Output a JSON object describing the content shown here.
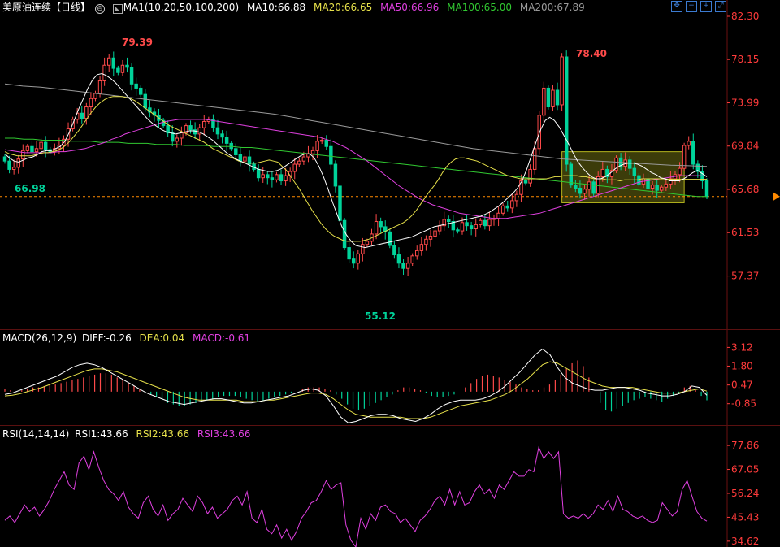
{
  "header": {
    "title": "美原油连续",
    "period": "【日线】",
    "ma_label": "MA1(10,20,50,100,200)",
    "ma10": "MA10:66.88",
    "ma20": "MA20:66.65",
    "ma50": "MA50:66.96",
    "ma100": "MA100:65.00",
    "ma200": "MA200:67.89",
    "icons": [
      "move-icon",
      "zoom-out-icon",
      "zoom-in-icon",
      "expand-icon"
    ]
  },
  "colors": {
    "up": "#ff4a4a",
    "down": "#00d39a",
    "ma10": "#ffffff",
    "ma20": "#e6e04a",
    "ma50": "#e040e0",
    "ma100": "#31c831",
    "ma200": "#9a9a9a",
    "axis": "#ff3b3b",
    "diff": "#ffffff",
    "dea": "#e6e04a",
    "rsi": "#e040e0",
    "box": "#b5b51e"
  },
  "price_axis": {
    "ticks": [
      "82.30",
      "78.15",
      "73.99",
      "69.84",
      "65.68",
      "61.53",
      "57.37"
    ],
    "range": [
      52.5,
      82.3
    ]
  },
  "annotations": {
    "high1": "79.39",
    "low1": "66.98",
    "high2": "78.40",
    "low2": "55.12",
    "last_price": "65.00"
  },
  "macd": {
    "label": "MACD(26,12,9)",
    "diff": "DIFF:-0.26",
    "dea": "DEA:0.04",
    "macd": "MACD:-0.61",
    "ticks": [
      "3.12",
      "1.80",
      "0.47",
      "-0.85"
    ],
    "range": [
      -2.3,
      3.2
    ]
  },
  "rsi": {
    "label": "RSI(14,14,14)",
    "rsi1": "RSI1:43.66",
    "rsi2": "RSI2:43.66",
    "rsi3": "RSI3:43.66",
    "ticks": [
      "77.86",
      "67.05",
      "56.24",
      "45.43",
      "34.62"
    ],
    "range": [
      32,
      79
    ]
  },
  "chart_data": {
    "type": "candlestick",
    "title": "美原油连续【日线】",
    "close": [
      68.4,
      67.6,
      67.8,
      68.6,
      69.4,
      69.8,
      69.3,
      69.6,
      70.2,
      69.5,
      69.3,
      69.6,
      69.9,
      70.5,
      71.5,
      72.4,
      73.0,
      72.5,
      73.6,
      74.4,
      74.9,
      76.1,
      77.6,
      78.3,
      77.3,
      76.9,
      77.6,
      77.4,
      75.8,
      75.4,
      74.8,
      73.5,
      73.1,
      72.8,
      72.3,
      71.8,
      71.1,
      70.3,
      70.6,
      71.1,
      71.8,
      71.4,
      71.0,
      71.6,
      72.2,
      72.4,
      71.6,
      71.0,
      70.7,
      70.1,
      69.6,
      69.0,
      68.4,
      68.8,
      68.1,
      67.6,
      66.8,
      67.1,
      66.8,
      66.6,
      67.1,
      66.5,
      67.0,
      67.4,
      68.1,
      68.4,
      68.8,
      69.1,
      69.4,
      70.3,
      70.4,
      69.8,
      68.1,
      66.0,
      62.7,
      60.1,
      59.0,
      58.6,
      59.5,
      60.4,
      60.7,
      61.4,
      62.6,
      62.1,
      61.6,
      60.3,
      59.4,
      58.6,
      58.1,
      58.6,
      59.3,
      59.8,
      60.4,
      60.9,
      61.2,
      61.7,
      62.2,
      62.8,
      62.6,
      61.8,
      61.7,
      62.5,
      62.2,
      61.9,
      62.3,
      62.7,
      62.2,
      62.8,
      62.9,
      63.4,
      64.1,
      63.9,
      64.6,
      65.2,
      66.5,
      66.3,
      67.6,
      69.6,
      72.8,
      75.4,
      73.6,
      75.2,
      73.8,
      78.4,
      68.1,
      66.1,
      65.8,
      65.3,
      65.7,
      66.4,
      65.3,
      66.9,
      67.6,
      66.9,
      67.5,
      68.7,
      67.9,
      68.5,
      67.7,
      67.0,
      66.2,
      66.7,
      65.8,
      66.1,
      65.6,
      65.9,
      66.2,
      66.7,
      67.1,
      67.7,
      69.9,
      70.3,
      68.1,
      67.4,
      66.5,
      65.0
    ],
    "ma10": [
      69.1,
      68.7,
      68.4,
      68.3,
      68.5,
      68.7,
      68.8,
      69.0,
      69.3,
      69.4,
      69.4,
      69.6,
      69.8,
      70.3,
      71.2,
      72.3,
      73.4,
      74.4,
      75.4,
      76.2,
      76.7,
      76.8,
      76.6,
      76.3,
      75.9,
      75.4,
      74.9,
      74.4,
      73.9,
      73.4,
      72.9,
      72.4,
      72.0,
      71.7,
      71.4,
      71.2,
      71.1,
      71.0,
      71.1,
      71.2,
      71.3,
      71.3,
      71.2,
      71.0,
      70.7,
      70.4,
      70.0,
      69.6,
      69.2,
      68.9,
      68.6,
      68.4,
      68.2,
      68.0,
      67.8,
      67.6,
      67.5,
      67.4,
      67.4,
      67.5,
      67.7,
      68.0,
      68.3,
      68.6,
      68.9,
      69.1,
      69.1,
      68.7,
      67.9,
      66.9,
      65.7,
      64.4,
      63.2,
      62.1,
      61.3,
      60.7,
      60.3,
      60.2,
      60.1,
      60.2,
      60.3,
      60.4,
      60.5,
      60.6,
      60.7,
      60.8,
      60.9,
      61.0,
      61.1,
      61.3,
      61.5,
      61.7,
      61.9,
      62.1,
      62.2,
      62.3,
      62.4,
      62.5,
      62.6,
      62.7,
      62.8,
      62.9,
      63.0,
      63.1,
      63.3,
      63.5,
      63.8,
      64.1,
      64.5,
      64.9,
      65.3,
      65.8,
      66.5,
      67.6,
      68.9,
      70.2,
      71.4,
      72.3,
      72.6,
      72.3,
      71.7,
      70.9,
      70.1,
      69.2,
      68.4,
      67.8,
      67.3,
      66.9,
      66.7,
      66.7,
      66.9,
      67.2,
      67.6,
      67.9,
      68.1,
      68.2,
      68.2,
      68.1,
      67.9,
      67.6,
      67.3,
      67.1,
      66.8,
      66.7,
      66.5,
      66.5,
      66.5,
      66.7,
      67.0,
      67.3,
      67.5,
      67.2,
      66.9
    ],
    "ma20": [
      69.3,
      69.1,
      69.0,
      68.9,
      68.9,
      68.9,
      68.9,
      69.0,
      69.1,
      69.2,
      69.2,
      69.3,
      69.4,
      69.6,
      69.9,
      70.3,
      70.8,
      71.3,
      71.9,
      72.5,
      73.1,
      73.6,
      74.0,
      74.3,
      74.5,
      74.6,
      74.6,
      74.6,
      74.5,
      74.4,
      74.2,
      73.9,
      73.6,
      73.3,
      73.0,
      72.7,
      72.4,
      72.1,
      71.8,
      71.6,
      71.4,
      71.2,
      71.0,
      70.8,
      70.6,
      70.4,
      70.2,
      69.9,
      69.6,
      69.4,
      69.2,
      69.0,
      68.8,
      68.6,
      68.4,
      68.3,
      68.2,
      68.2,
      68.2,
      68.3,
      68.4,
      68.5,
      68.4,
      68.3,
      67.9,
      67.5,
      66.9,
      66.3,
      65.7,
      65.0,
      64.3,
      63.6,
      63.0,
      62.4,
      61.9,
      61.5,
      61.2,
      61.0,
      60.8,
      60.7,
      60.7,
      60.7,
      60.7,
      60.8,
      60.9,
      61.1,
      61.3,
      61.5,
      61.7,
      61.9,
      62.1,
      62.3,
      62.5,
      62.8,
      63.2,
      63.7,
      64.3,
      64.9,
      65.5,
      66.0,
      66.6,
      67.3,
      67.9,
      68.3,
      68.6,
      68.7,
      68.7,
      68.6,
      68.5,
      68.4,
      68.2,
      68.0,
      67.8,
      67.6,
      67.4,
      67.2,
      67.0,
      66.9,
      66.8,
      66.7,
      66.7,
      66.7,
      66.7,
      66.7,
      66.7,
      66.7,
      66.8,
      66.9,
      66.9,
      67.0,
      67.0,
      67.0,
      67.0,
      66.9,
      66.9,
      66.8,
      66.7,
      66.7,
      66.7,
      66.6,
      66.6,
      66.6,
      66.5,
      66.6,
      66.6,
      66.6,
      66.6,
      66.7,
      66.7,
      66.7,
      66.7,
      66.7,
      66.7,
      66.65,
      66.65,
      66.65,
      66.65,
      66.65,
      66.65,
      66.65,
      66.65,
      66.65,
      66.65
    ],
    "ma50": [
      69.5,
      69.4,
      69.3,
      69.2,
      69.2,
      69.2,
      69.2,
      69.2,
      69.3,
      69.3,
      69.4,
      69.5,
      69.6,
      69.8,
      70.0,
      70.2,
      70.5,
      70.7,
      71.0,
      71.2,
      71.4,
      71.6,
      71.8,
      72.0,
      72.2,
      72.3,
      72.4,
      72.4,
      72.4,
      72.4,
      72.4,
      72.3,
      72.2,
      72.1,
      72.0,
      71.9,
      71.8,
      71.7,
      71.6,
      71.5,
      71.4,
      71.3,
      71.2,
      71.1,
      71.0,
      70.9,
      70.8,
      70.7,
      70.5,
      70.3,
      70.0,
      69.7,
      69.3,
      68.9,
      68.5,
      68.0,
      67.5,
      67.0,
      66.5,
      66.0,
      65.6,
      65.2,
      64.8,
      64.5,
      64.2,
      64.0,
      63.8,
      63.6,
      63.4,
      63.3,
      63.2,
      63.1,
      63.0,
      62.9,
      62.9,
      62.9,
      63.0,
      63.1,
      63.2,
      63.3,
      63.4,
      63.6,
      63.8,
      64.0,
      64.2,
      64.4,
      64.6,
      64.8,
      65.0,
      65.2,
      65.4,
      65.6,
      65.8,
      66.0,
      66.2,
      66.4,
      66.5,
      66.6,
      66.7,
      66.8,
      66.9,
      67.0,
      67.0,
      67.0,
      67.0,
      66.96
    ],
    "ma100": [
      70.6,
      70.6,
      70.5,
      70.5,
      70.4,
      70.4,
      70.4,
      70.3,
      70.3,
      70.3,
      70.2,
      70.2,
      70.2,
      70.1,
      70.1,
      70.1,
      70.0,
      70.0,
      70.0,
      69.9,
      69.9,
      69.9,
      69.8,
      69.8,
      69.8,
      69.7,
      69.7,
      69.6,
      69.5,
      69.4,
      69.3,
      69.2,
      69.1,
      69.0,
      68.9,
      68.8,
      68.7,
      68.6,
      68.5,
      68.4,
      68.3,
      68.2,
      68.1,
      68.0,
      67.9,
      67.8,
      67.7,
      67.6,
      67.5,
      67.4,
      67.3,
      67.2,
      67.1,
      67.0,
      66.9,
      66.8,
      66.7,
      66.6,
      66.5,
      66.4,
      66.3,
      66.2,
      66.1,
      66.0,
      65.9,
      65.8,
      65.7,
      65.6,
      65.5,
      65.4,
      65.3,
      65.2,
      65.1,
      65.0,
      65.0
    ],
    "ma200": [
      75.8,
      75.6,
      75.5,
      75.3,
      75.1,
      74.9,
      74.7,
      74.5,
      74.3,
      74.1,
      73.9,
      73.7,
      73.5,
      73.3,
      73.1,
      72.9,
      72.6,
      72.3,
      72.0,
      71.7,
      71.4,
      71.1,
      70.8,
      70.5,
      70.2,
      69.9,
      69.6,
      69.4,
      69.2,
      69.0,
      68.8,
      68.6,
      68.5,
      68.4,
      68.3,
      68.2,
      68.1,
      68.0,
      67.95,
      67.89
    ],
    "macd_hist": [
      0.2,
      0.1,
      0.0,
      0.1,
      0.2,
      0.3,
      0.3,
      0.4,
      0.5,
      0.5,
      0.6,
      0.7,
      0.8,
      0.9,
      1.0,
      1.1,
      1.2,
      1.3,
      1.3,
      1.2,
      1.0,
      0.8,
      0.6,
      0.4,
      0.2,
      0.0,
      -0.2,
      -0.4,
      -0.6,
      -0.8,
      -0.9,
      -1.0,
      -1.0,
      -0.9,
      -0.8,
      -0.7,
      -0.6,
      -0.5,
      -0.4,
      -0.3,
      -0.3,
      -0.3,
      -0.4,
      -0.5,
      -0.6,
      -0.7,
      -0.6,
      -0.5,
      -0.4,
      -0.3,
      -0.2,
      -0.1,
      0.0,
      0.2,
      0.3,
      0.3,
      0.3,
      0.2,
      0.1,
      -0.2,
      -0.5,
      -0.9,
      -1.2,
      -1.3,
      -1.2,
      -1.0,
      -0.8,
      -0.6,
      -0.4,
      -0.2,
      0.1,
      0.3,
      0.3,
      0.2,
      0.1,
      -0.1,
      -0.3,
      -0.4,
      -0.4,
      -0.3,
      -0.2,
      0.0,
      0.3,
      0.6,
      0.9,
      1.1,
      1.2,
      1.1,
      1.0,
      0.8,
      0.7,
      0.5,
      0.3,
      0.2,
      0.1,
      0.1,
      0.3,
      0.5,
      0.8,
      1.2,
      1.6,
      2.0,
      2.2,
      1.8,
      1.0,
      0.0,
      -0.8,
      -1.3,
      -1.4,
      -1.2,
      -1.0,
      -0.8,
      -0.6,
      -0.5,
      -0.4,
      -0.5,
      -0.6,
      -0.7,
      -0.5,
      -0.3,
      -0.1,
      0.3,
      0.4,
      0.1,
      -0.3,
      -0.61
    ],
    "macd_diff": [
      -0.2,
      -0.1,
      0.1,
      0.3,
      0.5,
      0.7,
      0.9,
      1.1,
      1.4,
      1.7,
      1.9,
      2.0,
      1.9,
      1.7,
      1.4,
      1.1,
      0.8,
      0.5,
      0.2,
      -0.1,
      -0.3,
      -0.5,
      -0.7,
      -0.8,
      -0.9,
      -0.8,
      -0.7,
      -0.6,
      -0.5,
      -0.5,
      -0.6,
      -0.7,
      -0.8,
      -0.8,
      -0.7,
      -0.6,
      -0.5,
      -0.4,
      -0.3,
      -0.1,
      0.1,
      0.2,
      0.1,
      -0.3,
      -1.0,
      -1.8,
      -2.2,
      -2.1,
      -1.9,
      -1.7,
      -1.6,
      -1.6,
      -1.7,
      -1.9,
      -2.0,
      -2.1,
      -1.9,
      -1.6,
      -1.2,
      -0.9,
      -0.7,
      -0.6,
      -0.6,
      -0.6,
      -0.5,
      -0.3,
      0.0,
      0.4,
      0.9,
      1.4,
      2.0,
      2.6,
      3.0,
      2.6,
      1.7,
      1.0,
      0.6,
      0.4,
      0.2,
      0.1,
      0.1,
      0.2,
      0.3,
      0.3,
      0.2,
      0.1,
      -0.1,
      -0.2,
      -0.3,
      -0.3,
      -0.2,
      0.0,
      0.4,
      0.3,
      -0.26
    ],
    "macd_dea": [
      -0.3,
      -0.25,
      -0.15,
      0.0,
      0.15,
      0.3,
      0.5,
      0.7,
      0.9,
      1.1,
      1.3,
      1.5,
      1.6,
      1.6,
      1.5,
      1.4,
      1.2,
      1.0,
      0.8,
      0.6,
      0.4,
      0.2,
      0.0,
      -0.2,
      -0.4,
      -0.5,
      -0.6,
      -0.6,
      -0.6,
      -0.6,
      -0.6,
      -0.6,
      -0.7,
      -0.7,
      -0.7,
      -0.6,
      -0.6,
      -0.5,
      -0.4,
      -0.3,
      -0.2,
      -0.1,
      -0.1,
      -0.2,
      -0.5,
      -0.9,
      -1.3,
      -1.6,
      -1.7,
      -1.8,
      -1.8,
      -1.8,
      -1.8,
      -1.8,
      -1.9,
      -1.9,
      -1.9,
      -1.8,
      -1.6,
      -1.4,
      -1.2,
      -1.0,
      -0.9,
      -0.8,
      -0.7,
      -0.6,
      -0.4,
      -0.2,
      0.1,
      0.5,
      0.9,
      1.4,
      1.9,
      2.1,
      2.0,
      1.7,
      1.4,
      1.1,
      0.8,
      0.6,
      0.4,
      0.3,
      0.3,
      0.3,
      0.3,
      0.2,
      0.1,
      0.0,
      -0.1,
      -0.1,
      -0.1,
      0.0,
      0.1,
      0.2,
      0.04
    ],
    "rsi": [
      44,
      46,
      43,
      47,
      51,
      48,
      50,
      46,
      49,
      53,
      58,
      62,
      66,
      60,
      58,
      70,
      73,
      67,
      75,
      68,
      62,
      58,
      56,
      53,
      57,
      50,
      47,
      45,
      52,
      55,
      49,
      46,
      51,
      44,
      47,
      49,
      54,
      51,
      48,
      55,
      52,
      47,
      50,
      45,
      47,
      49,
      53,
      55,
      51,
      57,
      45,
      43,
      49,
      40,
      38,
      42,
      36,
      40,
      35,
      39,
      45,
      48,
      52,
      53,
      57,
      62,
      58,
      60,
      61,
      42,
      35,
      32,
      45,
      40,
      47,
      44,
      50,
      51,
      48,
      47,
      43,
      45,
      42,
      39,
      44,
      46,
      49,
      53,
      55,
      51,
      58,
      51,
      57,
      51,
      52,
      57,
      60,
      56,
      58,
      54,
      60,
      58,
      62,
      66,
      64,
      64,
      67,
      66,
      77,
      72,
      75,
      72,
      75,
      47,
      45,
      46,
      45,
      47,
      45,
      47,
      51,
      49,
      53,
      48,
      55,
      49,
      48,
      46,
      45,
      46,
      44,
      43,
      44,
      52,
      49,
      46,
      48,
      58,
      62,
      55,
      48,
      45,
      43.66
    ]
  }
}
